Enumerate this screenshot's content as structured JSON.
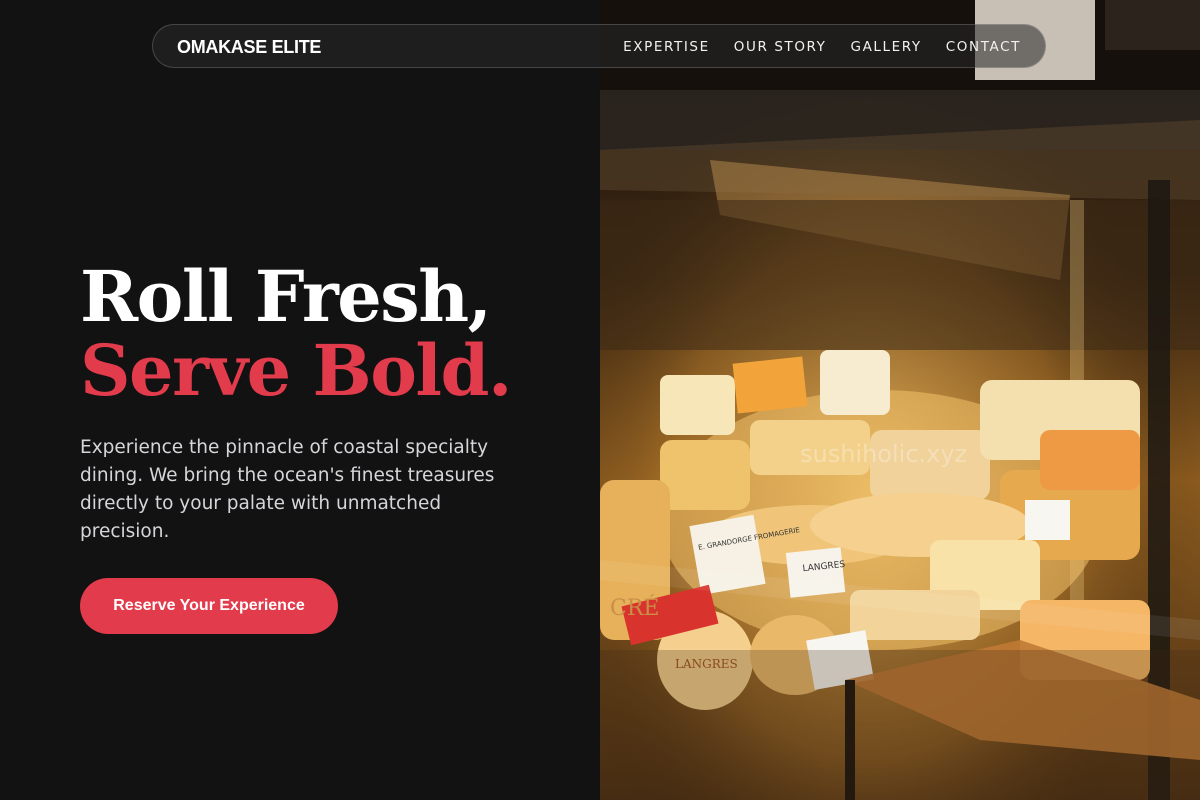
{
  "brand": "OMAKASE ELITE",
  "nav": {
    "items": [
      {
        "label": "EXPERTISE"
      },
      {
        "label": "OUR STORY"
      },
      {
        "label": "GALLERY"
      },
      {
        "label": "CONTACT"
      }
    ]
  },
  "hero": {
    "headline_line1": "Roll Fresh,",
    "headline_line2": "Serve Bold.",
    "subtitle": "Experience the pinnacle of coastal specialty dining. We bring the ocean's finest treasures directly to your palate with unmatched precision.",
    "cta_label": "Reserve Your Experience"
  },
  "photo": {
    "watermark": "sushiholic.xyz",
    "labels": [
      {
        "text": "LANGRES"
      },
      {
        "text": "E. GRANDORGE FROMAGERIE"
      },
      {
        "text": "LANGRES"
      },
      {
        "text": "CRÉ"
      }
    ]
  },
  "colors": {
    "accent": "#e23b4c",
    "background": "#121213",
    "text": "#ffffff"
  }
}
